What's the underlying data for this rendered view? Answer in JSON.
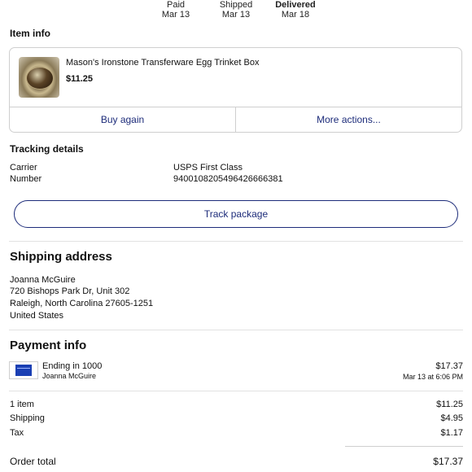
{
  "status_steps": [
    {
      "label": "Paid",
      "date": "Mar 13"
    },
    {
      "label": "Shipped",
      "date": "Mar 13"
    },
    {
      "label": "Delivered",
      "date": "Mar 18"
    }
  ],
  "item_info": {
    "title": "Item info",
    "item_name": "Mason's Ironstone Transferware Egg Trinket Box",
    "price": "$11.25",
    "buy_again": "Buy again",
    "more_actions": "More actions..."
  },
  "tracking": {
    "title": "Tracking details",
    "carrier_label": "Carrier",
    "carrier_value": "USPS First Class",
    "number_label": "Number",
    "number_value": "9400108205496426666381",
    "track_button": "Track package"
  },
  "shipping": {
    "title": "Shipping address",
    "name": "Joanna McGuire",
    "line1": "720 Bishops Park Dr, Unit 302",
    "line2": "Raleigh, North Carolina 27605-1251",
    "country": "United States"
  },
  "payment": {
    "title": "Payment info",
    "card_text": "Ending in 1000",
    "card_holder": "Joanna McGuire",
    "amount": "$17.37",
    "datetime": "Mar 13 at 6:06 PM"
  },
  "summary": {
    "items_label": "1 item",
    "items_value": "$11.25",
    "shipping_label": "Shipping",
    "shipping_value": "$4.95",
    "tax_label": "Tax",
    "tax_value": "$1.17",
    "total_label": "Order total",
    "total_value": "$17.37"
  },
  "colors": {
    "accent": "#1d2c7a",
    "divider": "#e2e2e2"
  }
}
